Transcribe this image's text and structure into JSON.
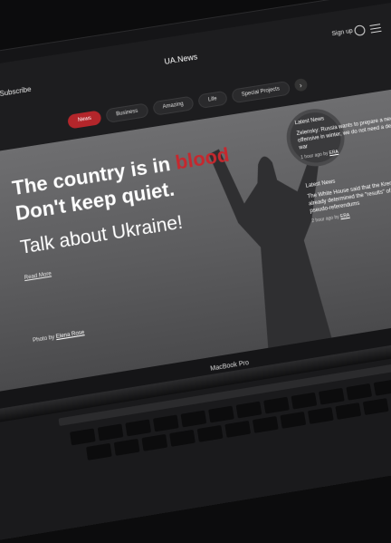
{
  "header": {
    "subscribe_label": "Subscribe",
    "logo": "UA.News",
    "signup_label": "Sign up"
  },
  "nav": {
    "tabs": [
      "News",
      "Business",
      "Amazing",
      "Life",
      "Special Projects"
    ],
    "active_tab": "News"
  },
  "hero": {
    "headline_line1_prefix": "The country is in ",
    "headline_line1_emphasis": "blood",
    "headline_line2": "Don't keep quiet.",
    "subheadline": "Talk about Ukraine!",
    "read_more": "Read More",
    "photo_credit_prefix": "Photo by",
    "photo_credit_author": "Elena Rose"
  },
  "latest_news": [
    {
      "heading": "Latest News",
      "body": "Zelensky: Russia wants to prepare a new offensive in winter, we do not need a delayed war",
      "time": "1 hour ago",
      "by_prefix": "by",
      "source": "ERA"
    },
    {
      "heading": "Latest News",
      "body": "The White House said that the Kremlin has already determined the \"results\" of the pseudo-referendums",
      "time": "2 hour ago",
      "by_prefix": "by",
      "source": "ERA"
    }
  ],
  "device": {
    "label": "MacBook Pro"
  },
  "colors": {
    "accent": "#c5282e",
    "background": "#1d1d1f"
  }
}
